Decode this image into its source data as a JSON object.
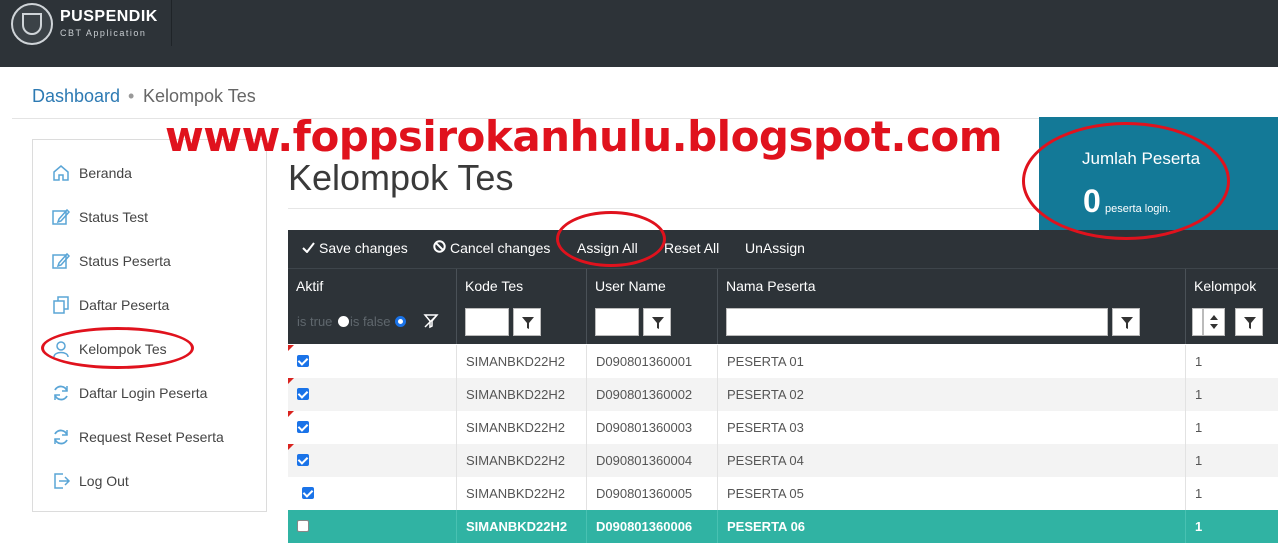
{
  "app": {
    "name": "PUSPENDIK",
    "subtitle": "CBT Application"
  },
  "breadcrumb": {
    "link": "Dashboard",
    "separator": "•",
    "current": "Kelompok Tes"
  },
  "watermark": "www.foppsirokanhulu.blogspot.com",
  "sidebar": {
    "items": [
      {
        "label": "Beranda",
        "icon": "home-icon"
      },
      {
        "label": "Status Test",
        "icon": "edit-icon"
      },
      {
        "label": "Status Peserta",
        "icon": "edit-icon"
      },
      {
        "label": "Daftar Peserta",
        "icon": "copy-icon"
      },
      {
        "label": "Kelompok Tes",
        "icon": "user-icon"
      },
      {
        "label": "Daftar Login Peserta",
        "icon": "refresh-icon"
      },
      {
        "label": "Request Reset Peserta",
        "icon": "refresh-icon"
      },
      {
        "label": "Log Out",
        "icon": "logout-icon"
      }
    ]
  },
  "page_title": "Kelompok Tes",
  "stat": {
    "label": "Jumlah Peserta",
    "value": "0",
    "unit": "peserta login."
  },
  "toolbar": {
    "save": "Save changes",
    "cancel": "Cancel changes",
    "assign_all": "Assign All",
    "reset_all": "Reset All",
    "unassign": "UnAssign"
  },
  "grid": {
    "columns": [
      "Aktif",
      "Kode Tes",
      "User Name",
      "Nama Peserta",
      "Kelompok"
    ],
    "filter": {
      "is_true": "is true",
      "is_false": "is false"
    },
    "rows": [
      {
        "aktif": true,
        "kode": "SIMANBKD22H2",
        "user": "D090801360001",
        "nama": "PESERTA 01",
        "kelompok": "1"
      },
      {
        "aktif": true,
        "kode": "SIMANBKD22H2",
        "user": "D090801360002",
        "nama": "PESERTA 02",
        "kelompok": "1"
      },
      {
        "aktif": true,
        "kode": "SIMANBKD22H2",
        "user": "D090801360003",
        "nama": "PESERTA 03",
        "kelompok": "1"
      },
      {
        "aktif": true,
        "kode": "SIMANBKD22H2",
        "user": "D090801360004",
        "nama": "PESERTA 04",
        "kelompok": "1"
      },
      {
        "aktif": true,
        "kode": "SIMANBKD22H2",
        "user": "D090801360005",
        "nama": "PESERTA 05",
        "kelompok": "1"
      },
      {
        "aktif": false,
        "kode": "SIMANBKD22H2",
        "user": "D090801360006",
        "nama": "PESERTA 06",
        "kelompok": "1"
      }
    ]
  },
  "colors": {
    "topbar": "#2d3338",
    "accent_link": "#2d7ab3",
    "stat_bg": "#137997",
    "selected_row": "#30b3a3",
    "annotation": "#e0121d"
  }
}
